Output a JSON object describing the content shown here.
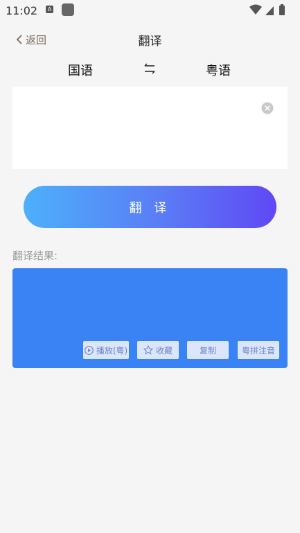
{
  "status_bar": {
    "time": "11:02",
    "notification_badge": "A"
  },
  "header": {
    "back_label": "返回",
    "title": "翻译"
  },
  "languages": {
    "source": "国语",
    "target": "粤语"
  },
  "input": {
    "value": "",
    "placeholder": ""
  },
  "translate_button_label": "翻 译",
  "result": {
    "label": "翻译结果:",
    "text": "",
    "actions": {
      "play": "播放(粤)",
      "favorite": "收藏",
      "copy": "复制",
      "pinyin": "粤拼注音"
    }
  },
  "colors": {
    "accent_start": "#4db0fb",
    "accent_end": "#6048f5",
    "result_bg": "#3a83f5",
    "back_text": "#7a6a60"
  },
  "icons": {
    "back": "chevron-left-icon",
    "swap": "swap-arrows-icon",
    "clear": "clear-circle-icon",
    "play": "play-circle-icon",
    "favorite": "star-icon"
  }
}
